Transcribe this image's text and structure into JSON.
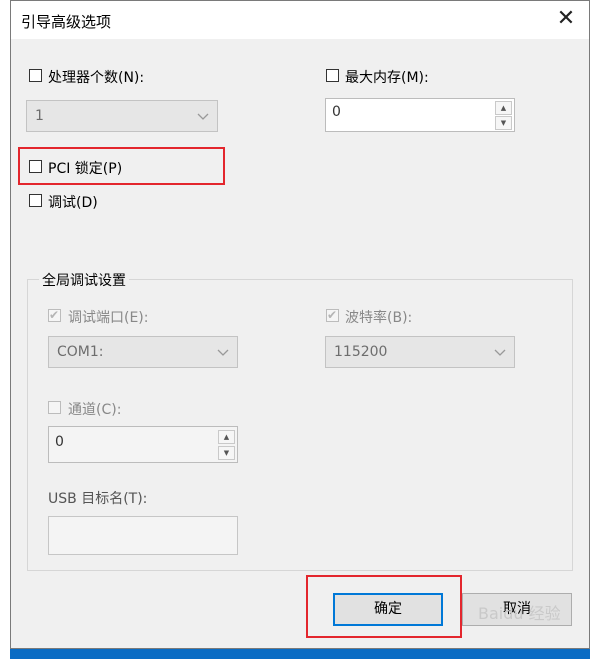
{
  "dialog": {
    "title": "引导高级选项",
    "close_glyph": "✕"
  },
  "processors": {
    "label": "处理器个数(N):",
    "checked": false,
    "value": "1"
  },
  "max_memory": {
    "label": "最大内存(M):",
    "checked": false,
    "value": "0"
  },
  "pci_lock": {
    "label": "PCI 锁定(P)",
    "checked": false
  },
  "debug": {
    "label": "调试(D)",
    "checked": false
  },
  "global_debug": {
    "group_title": "全局调试设置",
    "debug_port": {
      "label": "调试端口(E):",
      "checked": true,
      "value": "COM1:"
    },
    "baud_rate": {
      "label": "波特率(B):",
      "checked": true,
      "value": "115200"
    },
    "channel": {
      "label": "通道(C):",
      "checked": false,
      "value": "0"
    },
    "usb_target": {
      "label": "USB 目标名(T):",
      "value": ""
    }
  },
  "buttons": {
    "ok": "确定",
    "cancel": "取消"
  },
  "watermark": "Baidu 经验",
  "colors": {
    "highlight": "#e3262d",
    "focus": "#0078d7",
    "background": "#0a6cc4"
  }
}
